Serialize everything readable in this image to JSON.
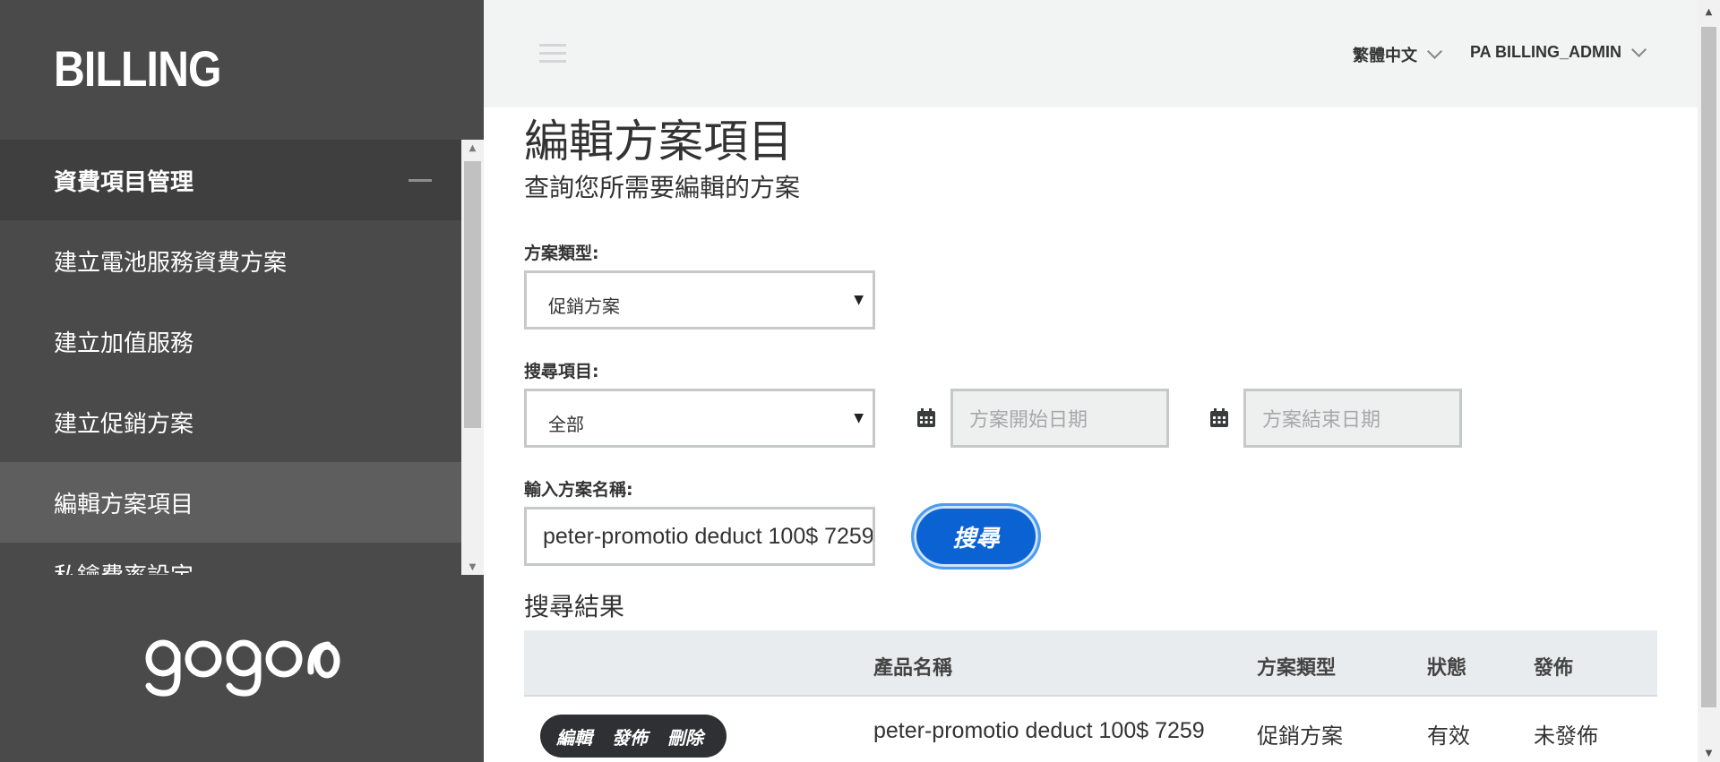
{
  "sidebar": {
    "brand": "BILLING",
    "group_label": "資費項目管理",
    "items": [
      {
        "label": "建立電池服務資費方案"
      },
      {
        "label": "建立加值服務"
      },
      {
        "label": "建立促銷方案"
      },
      {
        "label": "編輯方案項目"
      },
      {
        "label": "私鑰費率設定"
      }
    ],
    "logo_text": "gogoro"
  },
  "header": {
    "language": "繁體中文",
    "user": "PA BILLING_ADMIN"
  },
  "main": {
    "title": "編輯方案項目",
    "subtitle": "查詢您所需要編輯的方案",
    "plan_type_label": "方案類型:",
    "plan_type_value": "促銷方案",
    "search_item_label": "搜尋項目:",
    "search_item_value": "全部",
    "start_date_placeholder": "方案開始日期",
    "end_date_placeholder": "方案結束日期",
    "name_label": "輸入方案名稱:",
    "name_value": "peter-promotio deduct 100$ 7259",
    "search_button": "搜尋",
    "results_title": "搜尋結果"
  },
  "table": {
    "headers": [
      "產品名稱",
      "方案類型",
      "狀態",
      "發佈"
    ],
    "rows": [
      {
        "actions": [
          "編輯",
          "發佈",
          "刪除"
        ],
        "product_name": "peter-promotio deduct 100$ 7259",
        "plan_type": "促銷方案",
        "status": "有效",
        "publish": "未發佈"
      }
    ]
  },
  "colors": {
    "sidebar_bg": "#4a4a4a",
    "header_bg": "#f2f3f3",
    "primary_button": "#0b63d3",
    "table_header_bg": "#e9ecee"
  }
}
